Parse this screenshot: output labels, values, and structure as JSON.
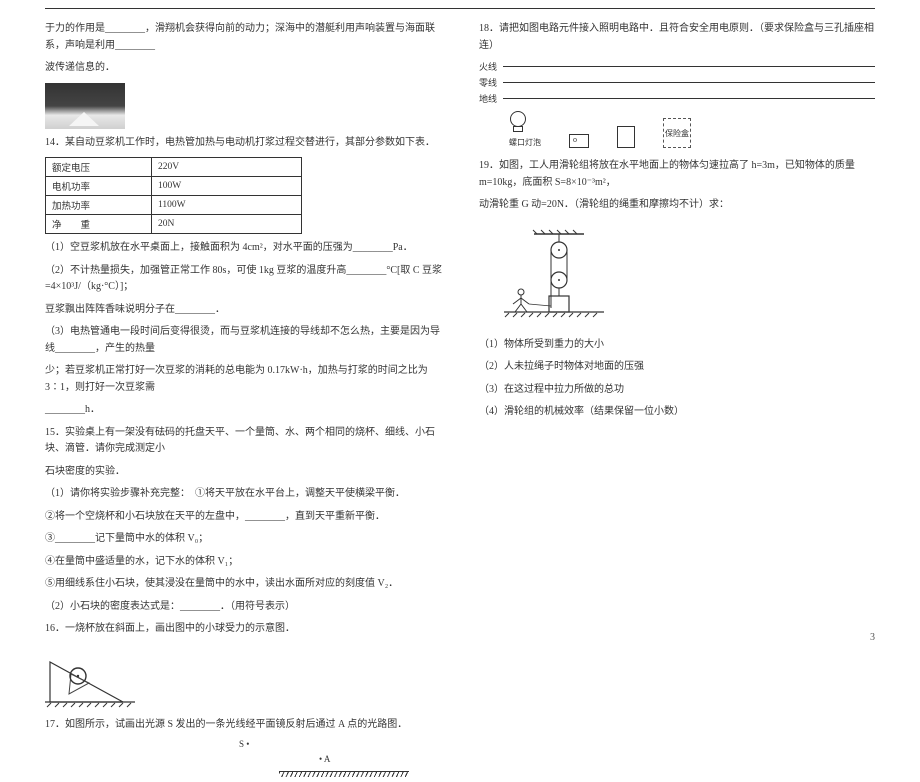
{
  "col1": {
    "q13_cont": "于力的作用是________，滑翔机会获得向前的动力；深海中的潜艇利用声响装置与海面联系，声响是利用________",
    "q13_end": "波传递信息的．",
    "q14_intro": "14．某自动豆浆机工作时，电热管加热与电动机打浆过程交替进行，其部分参数如下表．",
    "table": {
      "r1": {
        "a": "额定电压",
        "b": "220V"
      },
      "r2": {
        "a": "电机功率",
        "b": "100W"
      },
      "r3": {
        "a": "加热功率",
        "b": "1100W"
      },
      "r4": {
        "a": "净　　重",
        "b": "20N"
      }
    },
    "q14_1": "（1）空豆浆机放在水平桌面上，接触面积为 4cm²，对水平面的压强为________Pa．",
    "q14_2a": "（2）不计热量损失，加强管正常工作 80s，可使 1kg 豆浆的温度升高________°C[取 C 豆浆=4×10³J/（kg·°C）]；",
    "q14_2b": "豆浆飘出阵阵香味说明分子在________．",
    "q14_3a": "（3）电热管通电一段时间后变得很烫，而与豆浆机连接的导线却不怎么热，主要是因为导线________，产生的热量",
    "q14_3b": "少；若豆浆机正常打好一次豆浆的消耗的总电能为 0.17kW·h，加热与打浆的时间之比为 3∶1，则打好一次豆浆需",
    "q14_3c": "________h．",
    "q15_intro_a": "15．实验桌上有一架没有砝码的托盘天平、一个量筒、水、两个相同的烧杯、细线、小石块、滴管．请你完成测定小",
    "q15_intro_b": "石块密度的实验．",
    "q15_1": "（1）请你将实验步骤补充完整：　①将天平放在水平台上，调整天平使横梁平衡．",
    "q15_2": "②将一个空烧杯和小石块放在天平的左盘中，________，直到天平重新平衡．",
    "q15_3": "③________记下量筒中水的体积 V₀；",
    "q15_4": "④在量筒中盛适量的水，记下水的体积 V₁；",
    "q15_5": "⑤用细线系住小石块，使其浸没在量筒中的水中，读出水面所对应的刻度值 V₂．",
    "q15_6": "（2）小石块的密度表达式是：________．（用符号表示）",
    "q16": "16．一烧杯放在斜面上，画出图中的小球受力的示意图．",
    "q17": "17．如图所示，试画出光源 S 发出的一条光线经平面镜反射后通过 A 点的光路图．",
    "label_S": "S •",
    "label_A": "• A"
  },
  "col2": {
    "q18": "18．请把如图电路元件接入照明电路中．且符合安全用电原则．（要求保险盒与三孔插座相连）",
    "wire1": "火线",
    "wire2": "零线",
    "wire3": "地线",
    "bulb_label": "螺口灯泡",
    "fuse_label": "保险盒",
    "q19_a": "19．如图，工人用滑轮组将放在水平地面上的物体匀速拉高了 h=3m，已知物体的质量 m=10kg，底面积 S=8×10⁻³m²，",
    "q19_b": "动滑轮重 G 动=20N．（滑轮组的绳重和摩擦均不计）求：",
    "q19_1": "（1）物体所受到重力的大小",
    "q19_2": "（2）人未拉绳子时物体对地面的压强",
    "q19_3": "（3）在这过程中拉力所做的总功",
    "q19_4": "（4）滑轮组的机械效率（结果保留一位小数）"
  },
  "page_num": "3"
}
